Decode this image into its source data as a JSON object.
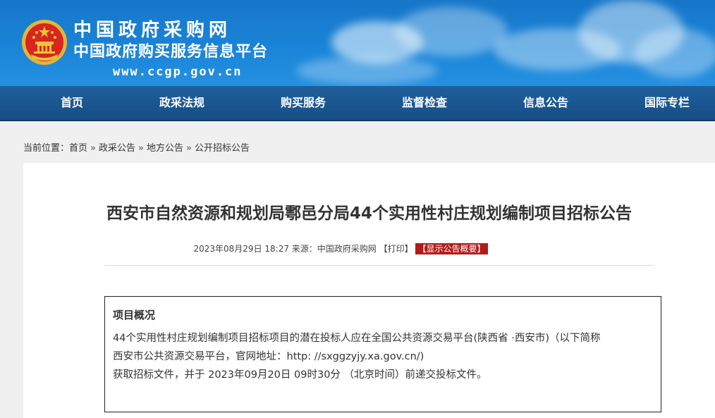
{
  "brand": {
    "name_cn": "中国政府采购网",
    "subtitle_cn": "中国政府购买服务信息平台",
    "url": "www.ccgp.gov.cn"
  },
  "nav": {
    "items": [
      {
        "label": "首页"
      },
      {
        "label": "政采法规"
      },
      {
        "label": "购买服务"
      },
      {
        "label": "监督检查"
      },
      {
        "label": "信息公告"
      },
      {
        "label": "国际专栏"
      }
    ]
  },
  "breadcrumb": {
    "prefix": "当前位置：",
    "items": [
      "首页",
      "政采公告",
      "地方公告",
      "公开招标公告"
    ],
    "separator": "»"
  },
  "article": {
    "title": "西安市自然资源和规划局鄠邑分局44个实用性村庄规划编制项目招标公告",
    "meta_date": "2023年08月29日 18:27",
    "meta_source": "来源：中国政府采购网",
    "print_label": "【打印】",
    "summary_button": "【显示公告概要】"
  },
  "overview": {
    "heading": "项目概况",
    "line1": "44个实用性村庄规划编制项目招标项目的潜在投标人应在全国公共资源交易平台(陕西省 ·西安市)（以下简称",
    "line2": "西安市公共资源交易平台，官网地址：http: //sxggzyjy.xa.gov.cn/)",
    "line3": "获取招标文件，并于 2023年09月20日 09时30分 （北京时间）前递交投标文件。"
  },
  "colors": {
    "banner_blue": "#1a84d8",
    "nav_blue": "#1a5690",
    "summary_red": "#b01c1c",
    "emblem_red": "#d8261f",
    "emblem_gold": "#f4c43c"
  }
}
